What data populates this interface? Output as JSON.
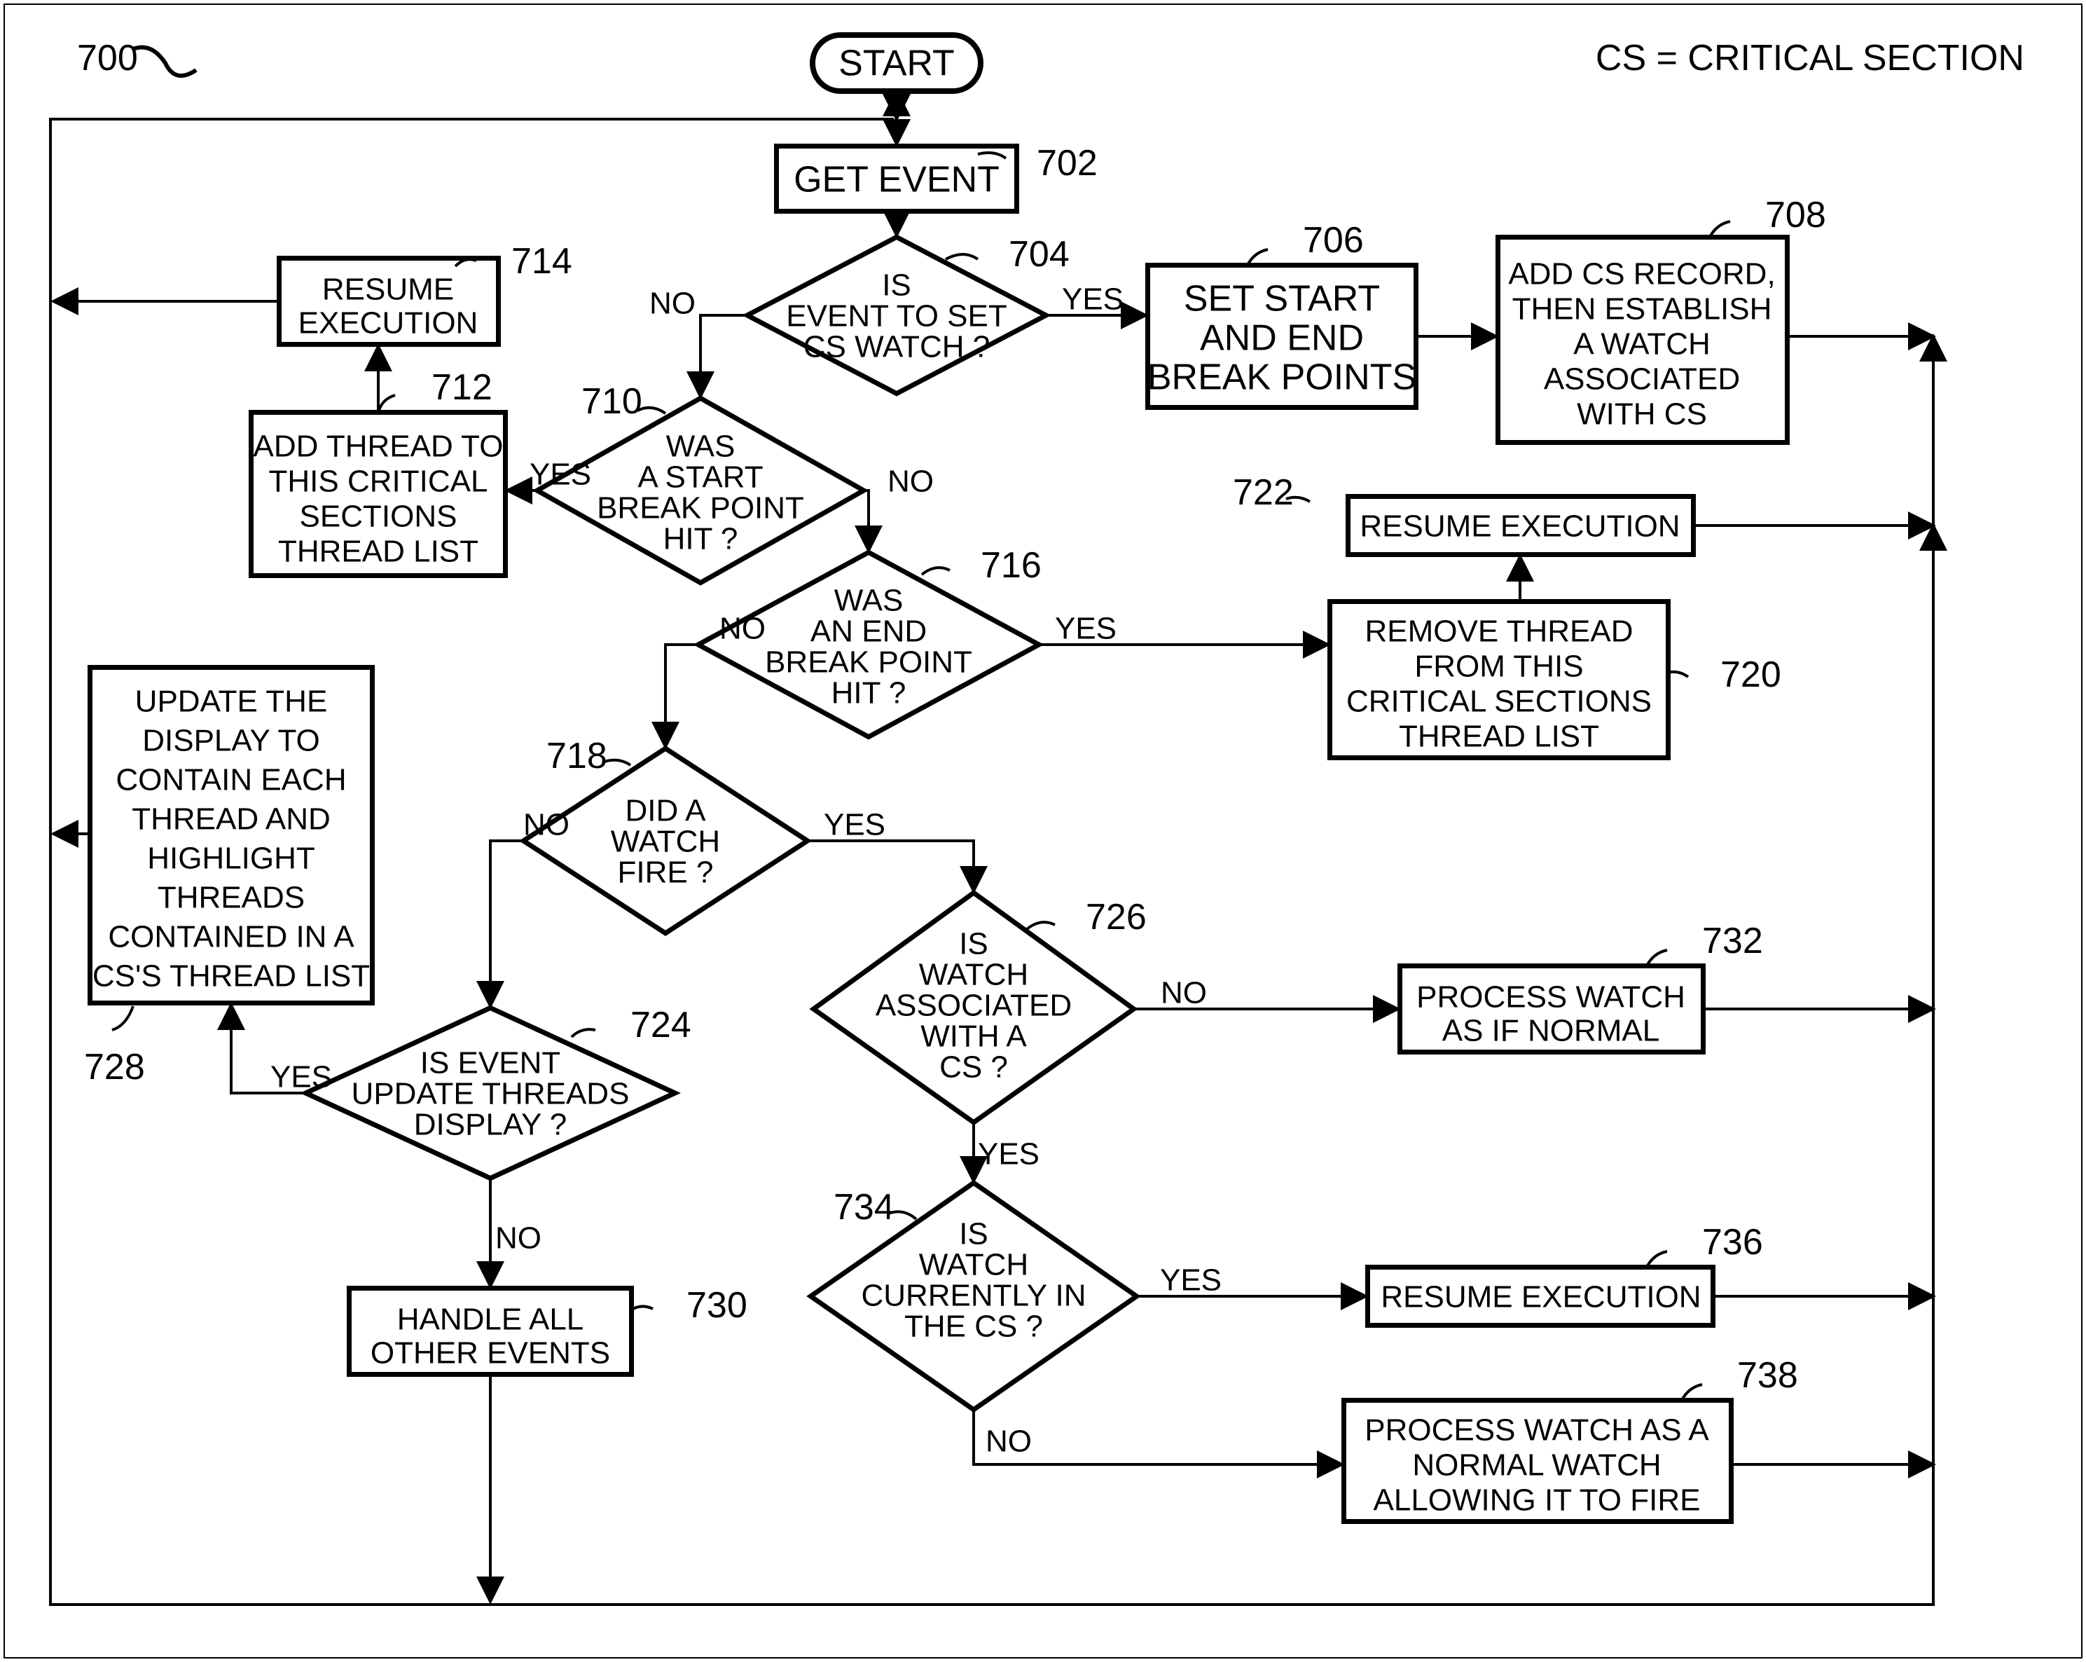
{
  "figure_label": "700",
  "legend": "CS = CRITICAL SECTION",
  "terminator_start": "START",
  "nodes": {
    "n702": {
      "ref": "702",
      "text": "GET EVENT"
    },
    "n704": {
      "ref": "704",
      "text": [
        "IS",
        "EVENT TO SET",
        "CS WATCH ?"
      ]
    },
    "n706": {
      "ref": "706",
      "text": [
        "SET START",
        "AND END",
        "BREAK POINTS"
      ]
    },
    "n708": {
      "ref": "708",
      "text": [
        "ADD CS RECORD,",
        "THEN ESTABLISH",
        "A WATCH",
        "ASSOCIATED",
        "WITH CS"
      ]
    },
    "n710": {
      "ref": "710",
      "text": [
        "WAS",
        "A START",
        "BREAK POINT",
        "HIT ?"
      ]
    },
    "n712": {
      "ref": "712",
      "text": [
        "ADD THREAD TO",
        "THIS CRITICAL",
        "SECTIONS",
        "THREAD LIST"
      ]
    },
    "n714": {
      "ref": "714",
      "text": [
        "RESUME",
        "EXECUTION"
      ]
    },
    "n716": {
      "ref": "716",
      "text": [
        "WAS",
        "AN END",
        "BREAK POINT",
        "HIT ?"
      ]
    },
    "n718": {
      "ref": "718",
      "text": [
        "DID A",
        "WATCH",
        "FIRE ?"
      ]
    },
    "n720": {
      "ref": "720",
      "text": [
        "REMOVE THREAD",
        "FROM THIS",
        "CRITICAL SECTIONS",
        "THREAD LIST"
      ]
    },
    "n722": {
      "ref": "722",
      "text": "RESUME EXECUTION"
    },
    "n724": {
      "ref": "724",
      "text": [
        "IS EVENT",
        "UPDATE THREADS",
        "DISPLAY ?"
      ]
    },
    "n726": {
      "ref": "726",
      "text": [
        "IS",
        "WATCH",
        "ASSOCIATED",
        "WITH A",
        "CS ?"
      ]
    },
    "n728": {
      "ref": "728",
      "text": [
        "UPDATE THE",
        "DISPLAY TO",
        "CONTAIN EACH",
        "THREAD AND",
        "HIGHLIGHT",
        "THREADS",
        "CONTAINED IN A",
        "CS'S THREAD LIST"
      ]
    },
    "n730": {
      "ref": "730",
      "text": [
        "HANDLE ALL",
        "OTHER EVENTS"
      ]
    },
    "n732": {
      "ref": "732",
      "text": [
        "PROCESS WATCH",
        "AS IF NORMAL"
      ]
    },
    "n734": {
      "ref": "734",
      "text": [
        "IS",
        "WATCH",
        "CURRENTLY IN",
        "THE CS ?"
      ]
    },
    "n736": {
      "ref": "736",
      "text": "RESUME EXECUTION"
    },
    "n738": {
      "ref": "738",
      "text": [
        "PROCESS WATCH AS A",
        "NORMAL WATCH",
        "ALLOWING IT TO FIRE"
      ]
    }
  },
  "edge_labels": {
    "yes": "YES",
    "no": "NO"
  }
}
